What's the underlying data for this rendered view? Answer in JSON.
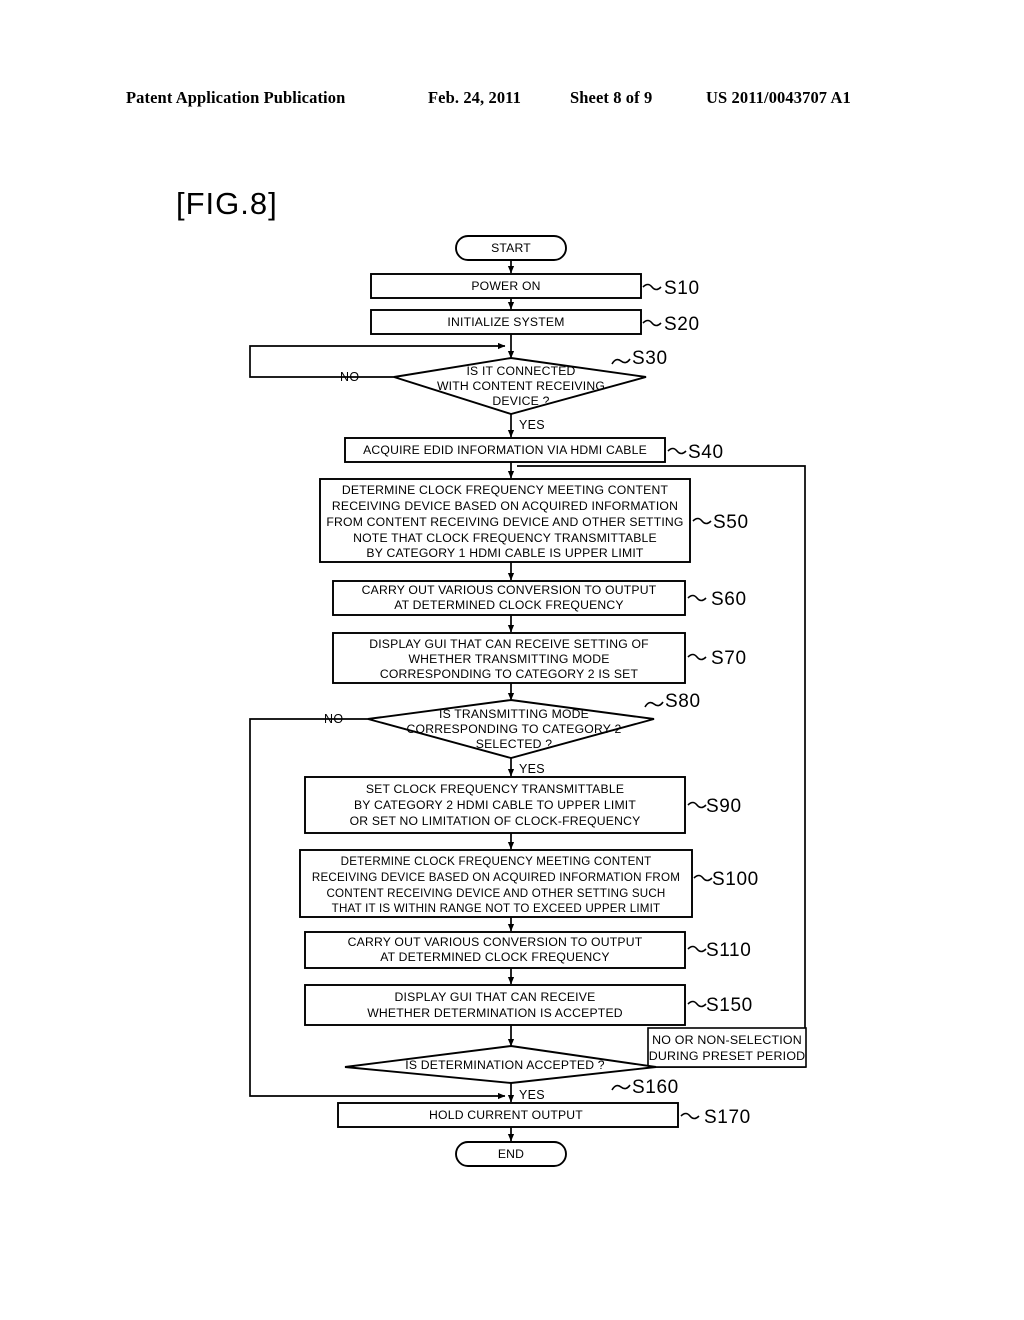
{
  "header": {
    "publication": "Patent Application Publication",
    "date": "Feb. 24, 2011",
    "sheet": "Sheet 8 of 9",
    "document_number": "US 2011/0043707 A1"
  },
  "figure": {
    "label": "[FIG.8]"
  },
  "chart_data": {
    "type": "flowchart",
    "title": "[FIG.8]",
    "nodes": [
      {
        "id": "start",
        "shape": "terminator",
        "step": "",
        "lines": [
          "START"
        ]
      },
      {
        "id": "s10",
        "shape": "process",
        "step": "S10",
        "lines": [
          "POWER ON"
        ]
      },
      {
        "id": "s20",
        "shape": "process",
        "step": "S20",
        "lines": [
          "INITIALIZE SYSTEM"
        ]
      },
      {
        "id": "s30",
        "shape": "decision",
        "step": "S30",
        "lines": [
          "IS IT CONNECTED",
          "WITH CONTENT RECEIVING",
          "DEVICE ?"
        ]
      },
      {
        "id": "s40",
        "shape": "process",
        "step": "S40",
        "lines": [
          "ACQUIRE EDID INFORMATION VIA HDMI CABLE"
        ]
      },
      {
        "id": "s50",
        "shape": "process",
        "step": "S50",
        "lines": [
          "DETERMINE CLOCK FREQUENCY MEETING CONTENT",
          "RECEIVING DEVICE BASED ON ACQUIRED INFORMATION",
          "FROM CONTENT RECEIVING DEVICE AND OTHER SETTING",
          "NOTE THAT CLOCK FREQUENCY TRANSMITTABLE",
          "BY CATEGORY 1 HDMI CABLE IS UPPER LIMIT"
        ]
      },
      {
        "id": "s60",
        "shape": "process",
        "step": "S60",
        "lines": [
          "CARRY OUT VARIOUS CONVERSION TO OUTPUT",
          "AT DETERMINED CLOCK FREQUENCY"
        ]
      },
      {
        "id": "s70",
        "shape": "process",
        "step": "S70",
        "lines": [
          "DISPLAY GUI THAT CAN RECEIVE SETTING OF",
          "WHETHER TRANSMITTING MODE",
          "CORRESPONDING TO CATEGORY 2 IS SET"
        ]
      },
      {
        "id": "s80",
        "shape": "decision",
        "step": "S80",
        "lines": [
          "IS TRANSMITTING MODE",
          "CORRESPONDING TO CATEGORY 2",
          "SELECTED ?"
        ]
      },
      {
        "id": "s90",
        "shape": "process",
        "step": "S90",
        "lines": [
          "SET CLOCK FREQUENCY TRANSMITTABLE",
          "BY CATEGORY 2 HDMI CABLE TO UPPER LIMIT",
          "OR SET NO LIMITATION OF CLOCK-FREQUENCY"
        ]
      },
      {
        "id": "s100",
        "shape": "process",
        "step": "S100",
        "lines": [
          "DETERMINE CLOCK FREQUENCY MEETING CONTENT",
          "RECEIVING DEVICE BASED ON ACQUIRED INFORMATION FROM",
          "CONTENT RECEIVING DEVICE AND OTHER SETTING SUCH",
          "THAT IT IS WITHIN RANGE NOT TO EXCEED UPPER LIMIT"
        ]
      },
      {
        "id": "s110",
        "shape": "process",
        "step": "S110",
        "lines": [
          "CARRY OUT VARIOUS CONVERSION TO OUTPUT",
          "AT DETERMINED CLOCK FREQUENCY"
        ]
      },
      {
        "id": "s150",
        "shape": "process",
        "step": "S150",
        "lines": [
          "DISPLAY GUI THAT CAN RECEIVE",
          "WHETHER DETERMINATION IS ACCEPTED"
        ]
      },
      {
        "id": "s160",
        "shape": "decision",
        "step": "S160",
        "lines": [
          "IS DETERMINATION ACCEPTED ?"
        ]
      },
      {
        "id": "s170",
        "shape": "process",
        "step": "S170",
        "lines": [
          "HOLD CURRENT OUTPUT"
        ]
      },
      {
        "id": "end",
        "shape": "terminator",
        "step": "",
        "lines": [
          "END"
        ]
      }
    ],
    "edge_labels": [
      {
        "id": "s30-no",
        "text": "NO"
      },
      {
        "id": "s30-yes",
        "text": "YES"
      },
      {
        "id": "s80-no",
        "text": "NO"
      },
      {
        "id": "s80-yes",
        "text": "YES"
      },
      {
        "id": "s160-yes",
        "text": "YES"
      }
    ],
    "annotations": [
      {
        "id": "s160-no-note",
        "lines": [
          "NO OR NON-SELECTION",
          "DURING PRESET PERIOD"
        ]
      }
    ],
    "edges": [
      {
        "from": "start",
        "to": "s10",
        "label": ""
      },
      {
        "from": "s10",
        "to": "s20",
        "label": ""
      },
      {
        "from": "s20",
        "to": "s30",
        "label": ""
      },
      {
        "from": "s30",
        "to": "s30",
        "label": "NO"
      },
      {
        "from": "s30",
        "to": "s40",
        "label": "YES"
      },
      {
        "from": "s40",
        "to": "s50",
        "label": ""
      },
      {
        "from": "s50",
        "to": "s60",
        "label": ""
      },
      {
        "from": "s60",
        "to": "s70",
        "label": ""
      },
      {
        "from": "s70",
        "to": "s80",
        "label": ""
      },
      {
        "from": "s80",
        "to": "s170",
        "label": "NO"
      },
      {
        "from": "s80",
        "to": "s90",
        "label": "YES"
      },
      {
        "from": "s90",
        "to": "s100",
        "label": ""
      },
      {
        "from": "s100",
        "to": "s110",
        "label": ""
      },
      {
        "from": "s110",
        "to": "s150",
        "label": ""
      },
      {
        "from": "s150",
        "to": "s160",
        "label": ""
      },
      {
        "from": "s160",
        "to": "s170",
        "label": "YES"
      },
      {
        "from": "s160",
        "to": "s50",
        "label": "NO OR NON-SELECTION DURING PRESET PERIOD"
      },
      {
        "from": "s170",
        "to": "end",
        "label": ""
      }
    ]
  }
}
